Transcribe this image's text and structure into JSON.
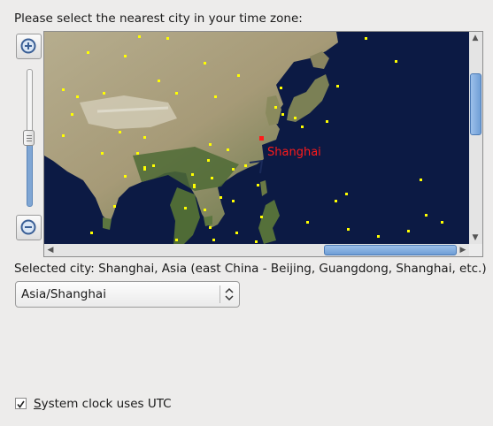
{
  "prompt": "Please select the nearest city in your time zone:",
  "map": {
    "highlighted_city": "Shanghai",
    "highlight_color": "#ff1a1a",
    "city_dot_color": "#ffff00",
    "ocean_color": "#0c1a44"
  },
  "zoom": {
    "in_icon": "zoom-in-icon",
    "out_icon": "zoom-out-icon"
  },
  "selected_city": "Selected city: Shanghai, Asia (east China - Beijing, Guangdong, Shanghai, etc.)",
  "timezone_select": {
    "value": "Asia/Shanghai"
  },
  "utc_checkbox": {
    "mnemonic": "S",
    "label_rest": "ystem clock uses UTC",
    "checked": true
  },
  "colors": {
    "background": "#edeceb",
    "scroll_accent": "#7fa6d4"
  }
}
